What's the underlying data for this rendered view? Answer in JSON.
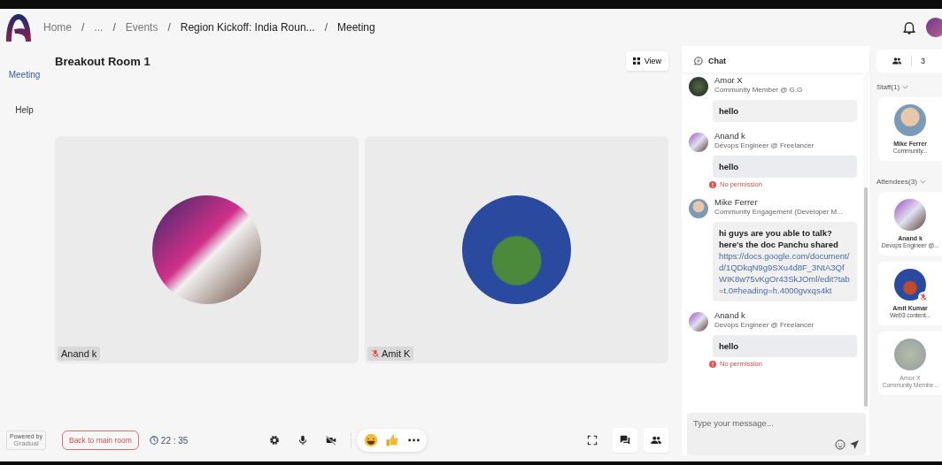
{
  "header": {
    "separator": "/",
    "breadcrumbs": [
      {
        "label": "Home",
        "current": false
      },
      {
        "label": "...",
        "current": false
      },
      {
        "label": "Events",
        "current": false
      },
      {
        "label": "Region Kickoff: India Roun...",
        "current": true
      },
      {
        "label": "Meeting",
        "current": true
      }
    ]
  },
  "nav": [
    {
      "label": "Meeting",
      "selected": true
    },
    {
      "label": "Help",
      "selected": false
    }
  ],
  "room": {
    "title": "Breakout Room 1",
    "view_button": "View"
  },
  "tiles": [
    {
      "name": "Anand k",
      "muted": false
    },
    {
      "name": "Amit K",
      "muted": true
    }
  ],
  "chat": {
    "title": "Chat",
    "placeholder": "Type your message...",
    "messages": [
      {
        "name": "Amor X",
        "subtitle": "Community Member @ G.G",
        "text": "hello"
      },
      {
        "name": "Anand k",
        "subtitle": "Devops Engineer @ Freelancer",
        "text": "hello",
        "error": "No permission"
      },
      {
        "name": "Mike Ferrer",
        "subtitle": "Community Engagement (Developer M...",
        "text": "hi guys are you able to talk? here's the doc Panchu shared",
        "link": "https://docs.google.com/document/d/1QDkqN9g9SXu4d8F_3NtA3QfWIK8w75vKgOr43SkJOml/edit?tab=t.0#heading=h.4000gvxqs4kt"
      },
      {
        "name": "Anand k",
        "subtitle": "Devops Engineer @ Freelancer",
        "text": "hello",
        "error": "No permission"
      }
    ]
  },
  "participants": {
    "count": "3",
    "sections": [
      {
        "label": "Staff(1)",
        "people": [
          {
            "name": "Mike Ferrer",
            "role": "Community...",
            "muted": false,
            "dimmed": false
          }
        ]
      },
      {
        "label": "Attendees(3)",
        "people": [
          {
            "name": "Anand k",
            "role": "Devops Engineer @...",
            "muted": false,
            "dimmed": false
          },
          {
            "name": "Amit Kumar",
            "role": "Web3 content...",
            "muted": true,
            "dimmed": false
          },
          {
            "name": "Amor X",
            "role": "Community Membe...",
            "muted": false,
            "dimmed": true
          }
        ]
      }
    ]
  },
  "footer": {
    "powered_by": "Powered by",
    "brand": "Gradual",
    "back_button": "Back to main room",
    "timer": "22 : 35"
  }
}
